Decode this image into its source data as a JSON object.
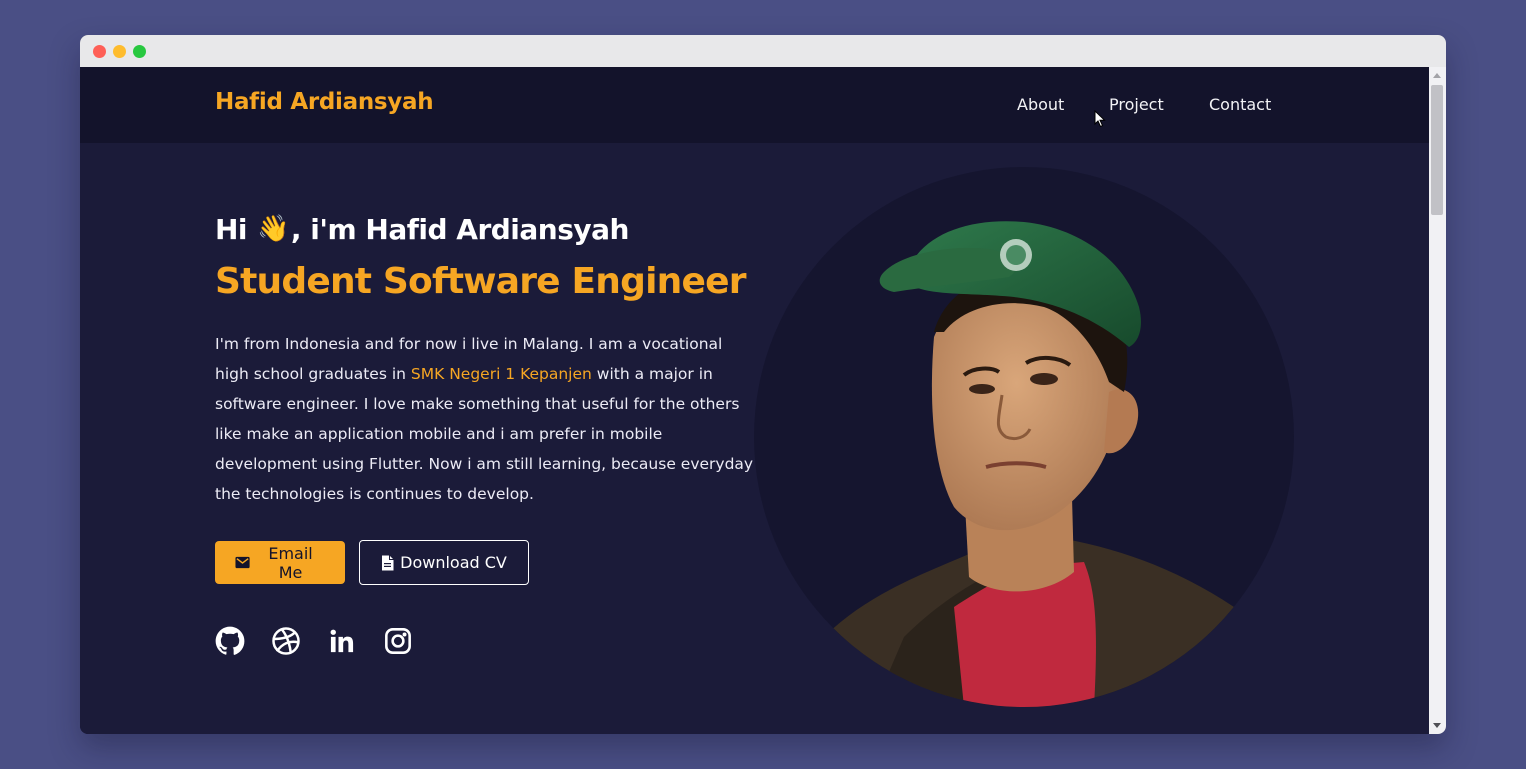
{
  "navbar": {
    "brand": "Hafid Ardiansyah",
    "links": [
      "About",
      "Project",
      "Contact"
    ]
  },
  "hero": {
    "greeting_prefix": "Hi",
    "greeting_emoji": "👋",
    "greeting_suffix": ", i'm Hafid Ardiansyah",
    "role": "Student Software Engineer",
    "bio_part1": "I'm from Indonesia and for now i live in Malang. I am a vocational high school graduates in ",
    "bio_school": "SMK Negeri 1 Kepanjen",
    "bio_part2": " with a major in software engineer. I love make something that useful for the others like make an application mobile and i am prefer in mobile development using Flutter. Now i am still learning, because everyday the technologies is continues to develop."
  },
  "buttons": {
    "email": {
      "label": "Email Me",
      "icon": "mail-icon"
    },
    "cv": {
      "label": "Download CV",
      "icon": "document-icon"
    }
  },
  "socials": [
    "github-icon",
    "dribbble-icon",
    "linkedin-icon",
    "instagram-icon"
  ],
  "colors": {
    "accent": "#f6a623",
    "background": "#1b1b39",
    "navbar": "#13132b",
    "desktop": "#4a4f85"
  }
}
